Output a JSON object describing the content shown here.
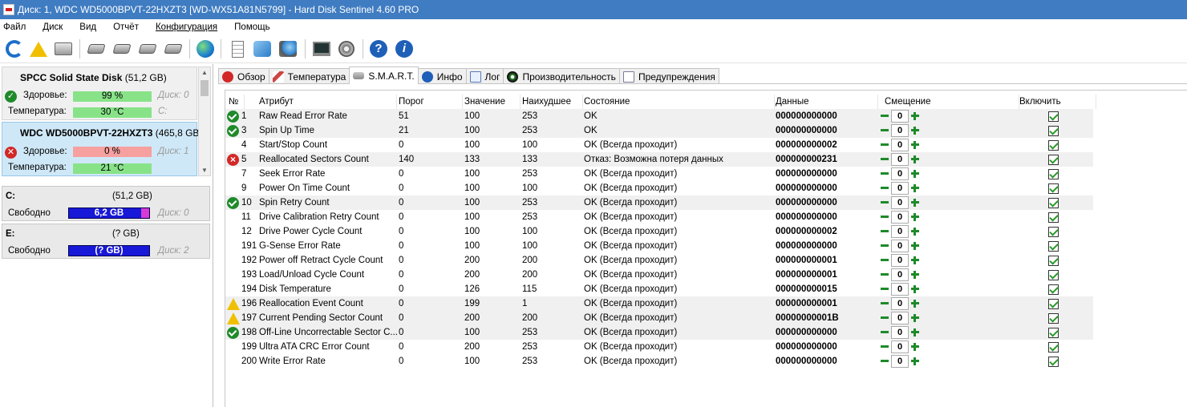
{
  "window": {
    "title": "Диск: 1, WDC WD5000BPVT-22HXZT3 [WD-WX51A81N5799]  -  Hard Disk Sentinel 4.60 PRO"
  },
  "menu": [
    "Файл",
    "Диск",
    "Вид",
    "Отчёт",
    "Конфигурация",
    "Помощь"
  ],
  "toolbar": {
    "icons": [
      "refresh-icon",
      "warning-icon",
      "disk-icon",
      "hdd-icon",
      "hdd-icon",
      "hdd-check-icon",
      "hdd-tool-icon",
      "globe-icon",
      "report-icon",
      "sync-icon",
      "network-icon",
      "monitor-icon",
      "speaker-icon",
      "help-icon",
      "info-icon"
    ]
  },
  "disks": [
    {
      "name": "SPCC Solid State Disk",
      "size": "(51,2 GB)",
      "health_label": "Здоровье:",
      "health": "99 %",
      "health_value": 99,
      "disk_label": "Диск: 0",
      "temp_label": "Температура:",
      "temp": "30 °C",
      "drive": "C:",
      "status": "ok"
    },
    {
      "name": "WDC WD5000BPVT-22HXZT3",
      "size": "(465,8 GB)",
      "health_label": "Здоровье:",
      "health": "0 %",
      "health_value": 0,
      "disk_label": "Диск: 1",
      "temp_label": "Температура:",
      "temp": "21 °C",
      "drive": "",
      "status": "error"
    }
  ],
  "volumes": [
    {
      "letter": "C:",
      "size": "(51,2 GB)",
      "free_label": "Свободно",
      "free": "6,2 GB",
      "disk_label": "Диск: 0"
    },
    {
      "letter": "E:",
      "size": "(? GB)",
      "free_label": "Свободно",
      "free": "(? GB)",
      "disk_label": "Диск: 2"
    }
  ],
  "tabs": [
    {
      "label": "Обзор",
      "icon": "error-icon"
    },
    {
      "label": "Температура",
      "icon": "thermometer-icon"
    },
    {
      "label": "S.M.A.R.T.",
      "icon": "smart-icon"
    },
    {
      "label": "Инфо",
      "icon": "info-icon"
    },
    {
      "label": "Лог",
      "icon": "log-icon"
    },
    {
      "label": "Производительность",
      "icon": "performance-icon"
    },
    {
      "label": "Предупреждения",
      "icon": "warnings-icon"
    }
  ],
  "active_tab": "S.M.A.R.T.",
  "smart": {
    "columns": {
      "num": "№",
      "attr": "Атрибут",
      "threshold": "Порог",
      "value": "Значение",
      "worst": "Наихудшее",
      "state": "Состояние",
      "data": "Данные",
      "offset": "Смещение",
      "enable": "Включить"
    },
    "rows": [
      {
        "num": "1",
        "attr": "Raw Read Error Rate",
        "threshold": "51",
        "value": "100",
        "worst": "253",
        "state": "OK",
        "data": "000000000000",
        "offset": "0",
        "status": "ok",
        "enabled": true
      },
      {
        "num": "3",
        "attr": "Spin Up Time",
        "threshold": "21",
        "value": "100",
        "worst": "253",
        "state": "OK",
        "data": "000000000000",
        "offset": "0",
        "status": "ok",
        "enabled": true
      },
      {
        "num": "4",
        "attr": "Start/Stop Count",
        "threshold": "0",
        "value": "100",
        "worst": "100",
        "state": "OK (Всегда проходит)",
        "data": "000000000002",
        "offset": "0",
        "status": "none",
        "enabled": true
      },
      {
        "num": "5",
        "attr": "Reallocated Sectors Count",
        "threshold": "140",
        "value": "133",
        "worst": "133",
        "state": "Отказ: Возможна потеря данных",
        "data": "000000000231",
        "offset": "0",
        "status": "error",
        "enabled": true
      },
      {
        "num": "7",
        "attr": "Seek Error Rate",
        "threshold": "0",
        "value": "100",
        "worst": "253",
        "state": "OK (Всегда проходит)",
        "data": "000000000000",
        "offset": "0",
        "status": "none",
        "enabled": true
      },
      {
        "num": "9",
        "attr": "Power On Time Count",
        "threshold": "0",
        "value": "100",
        "worst": "100",
        "state": "OK (Всегда проходит)",
        "data": "000000000000",
        "offset": "0",
        "status": "none",
        "enabled": true
      },
      {
        "num": "10",
        "attr": "Spin Retry Count",
        "threshold": "0",
        "value": "100",
        "worst": "253",
        "state": "OK (Всегда проходит)",
        "data": "000000000000",
        "offset": "0",
        "status": "ok",
        "enabled": true
      },
      {
        "num": "11",
        "attr": "Drive Calibration Retry Count",
        "threshold": "0",
        "value": "100",
        "worst": "253",
        "state": "OK (Всегда проходит)",
        "data": "000000000000",
        "offset": "0",
        "status": "none",
        "enabled": true
      },
      {
        "num": "12",
        "attr": "Drive Power Cycle Count",
        "threshold": "0",
        "value": "100",
        "worst": "100",
        "state": "OK (Всегда проходит)",
        "data": "000000000002",
        "offset": "0",
        "status": "none",
        "enabled": true
      },
      {
        "num": "191",
        "attr": "G-Sense Error Rate",
        "threshold": "0",
        "value": "100",
        "worst": "100",
        "state": "OK (Всегда проходит)",
        "data": "000000000000",
        "offset": "0",
        "status": "none",
        "enabled": true
      },
      {
        "num": "192",
        "attr": "Power off Retract Cycle Count",
        "threshold": "0",
        "value": "200",
        "worst": "200",
        "state": "OK (Всегда проходит)",
        "data": "000000000001",
        "offset": "0",
        "status": "none",
        "enabled": true
      },
      {
        "num": "193",
        "attr": "Load/Unload Cycle Count",
        "threshold": "0",
        "value": "200",
        "worst": "200",
        "state": "OK (Всегда проходит)",
        "data": "000000000001",
        "offset": "0",
        "status": "none",
        "enabled": true
      },
      {
        "num": "194",
        "attr": "Disk Temperature",
        "threshold": "0",
        "value": "126",
        "worst": "115",
        "state": "OK (Всегда проходит)",
        "data": "000000000015",
        "offset": "0",
        "status": "none",
        "enabled": true
      },
      {
        "num": "196",
        "attr": "Reallocation Event Count",
        "threshold": "0",
        "value": "199",
        "worst": "1",
        "state": "OK (Всегда проходит)",
        "data": "000000000001",
        "offset": "0",
        "status": "warn",
        "enabled": true
      },
      {
        "num": "197",
        "attr": "Current Pending Sector Count",
        "threshold": "0",
        "value": "200",
        "worst": "200",
        "state": "OK (Всегда проходит)",
        "data": "00000000001B",
        "offset": "0",
        "status": "warn",
        "enabled": true
      },
      {
        "num": "198",
        "attr": "Off-Line Uncorrectable Sector C...",
        "threshold": "0",
        "value": "100",
        "worst": "253",
        "state": "OK (Всегда проходит)",
        "data": "000000000000",
        "offset": "0",
        "status": "ok",
        "enabled": true
      },
      {
        "num": "199",
        "attr": "Ultra ATA CRC Error Count",
        "threshold": "0",
        "value": "200",
        "worst": "253",
        "state": "OK (Всегда проходит)",
        "data": "000000000000",
        "offset": "0",
        "status": "none",
        "enabled": true
      },
      {
        "num": "200",
        "attr": "Write Error Rate",
        "threshold": "0",
        "value": "100",
        "worst": "253",
        "state": "OK (Всегда проходит)",
        "data": "000000000000",
        "offset": "0",
        "status": "none",
        "enabled": true
      }
    ]
  },
  "colors": {
    "titlebar": "#3f7cc2",
    "health_ok": "#88e388",
    "health_bad": "#f6a0a0",
    "free_bar": "#1818d8",
    "selected_disk": "#cfe8f7",
    "alt_row": "#f0f0f0"
  }
}
